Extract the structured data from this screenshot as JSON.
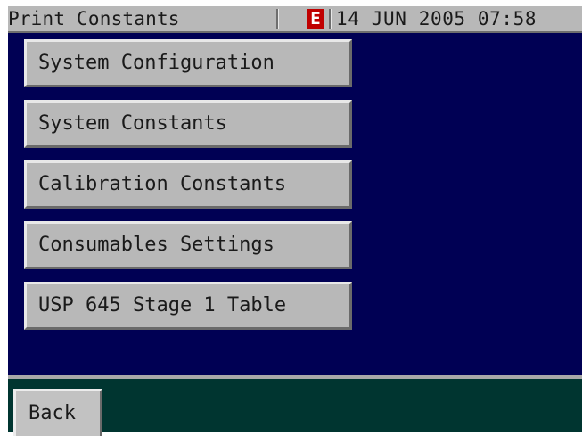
{
  "header": {
    "title": "Print Constants",
    "error_indicator": "E",
    "datetime": "14 JUN 2005 07:58"
  },
  "menu": {
    "items": [
      {
        "label": "System Configuration"
      },
      {
        "label": "System Constants"
      },
      {
        "label": "Calibration Constants"
      },
      {
        "label": "Consumables Settings"
      },
      {
        "label": "USP 645 Stage 1 Table"
      }
    ]
  },
  "footer": {
    "back_label": "Back"
  },
  "colors": {
    "main_background": "#000054",
    "footer_background": "#003530",
    "button_face": "#b8b8b8",
    "error_badge": "#c00000"
  }
}
